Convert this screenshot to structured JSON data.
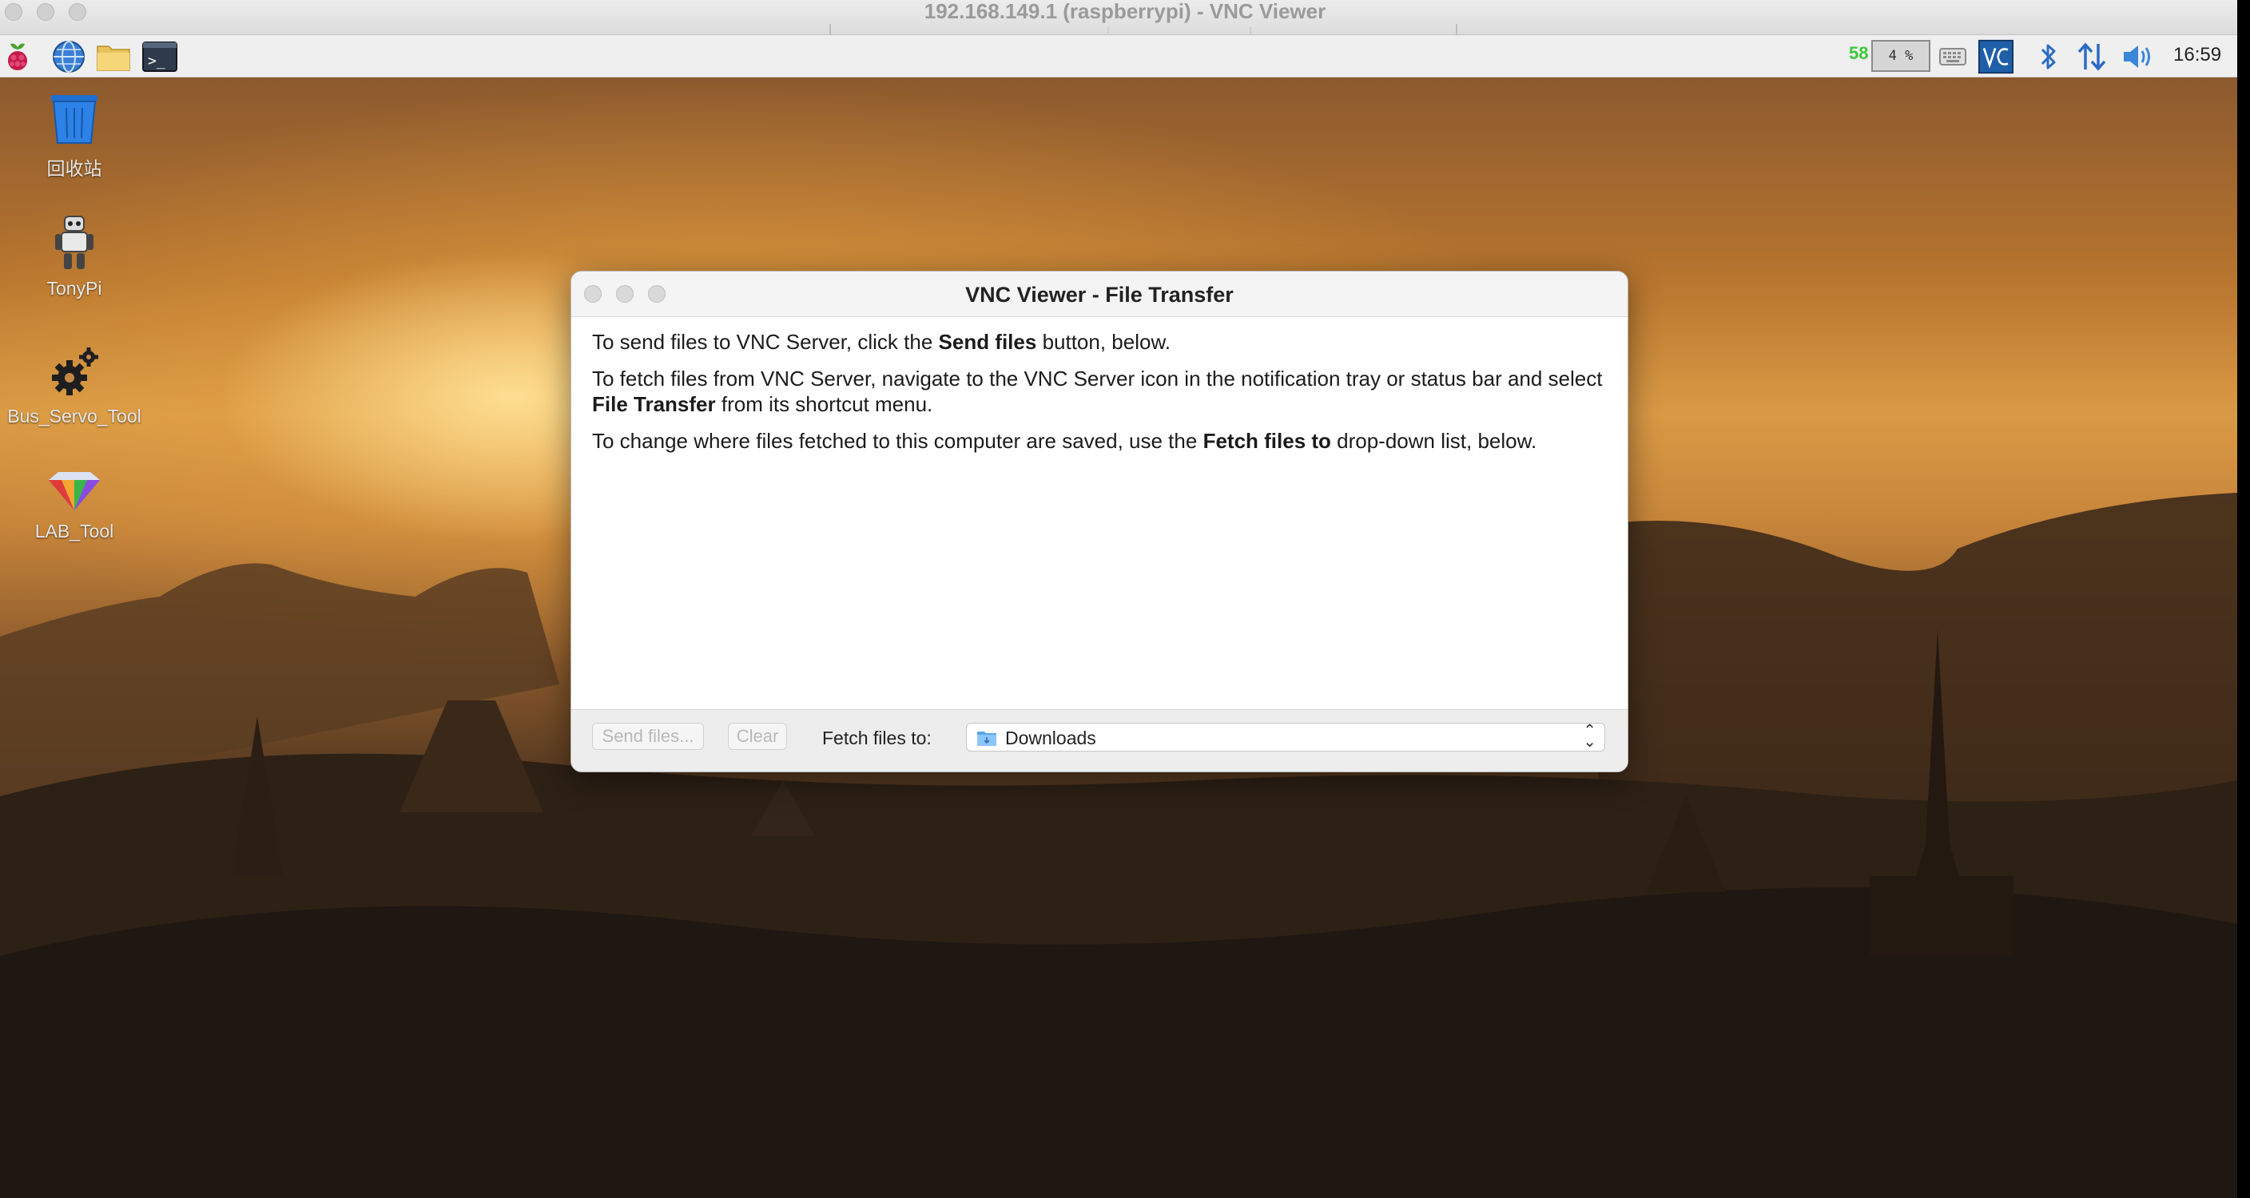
{
  "window": {
    "title": "192.168.149.1 (raspberrypi) - VNC Viewer"
  },
  "panel": {
    "launchers": [
      {
        "name": "raspberry-menu-icon"
      },
      {
        "name": "web-browser-icon"
      },
      {
        "name": "file-manager-icon"
      },
      {
        "name": "terminal-icon"
      }
    ],
    "cpu_temp": "58",
    "cpu_usage": "4 %",
    "clock": "16:59",
    "tray_icons": [
      "keyboard-icon",
      "vnc-icon",
      "bluetooth-icon",
      "network-icon",
      "volume-icon"
    ]
  },
  "desktop": {
    "icons": [
      {
        "label": "回收站",
        "icon": "trash-icon"
      },
      {
        "label": "TonyPi",
        "icon": "robot-icon"
      },
      {
        "label": "Bus_Servo_Tool",
        "icon": "gear-icon"
      },
      {
        "label": "LAB_Tool",
        "icon": "diamond-icon"
      }
    ]
  },
  "dialog": {
    "title": "VNC Viewer - File Transfer",
    "para1": {
      "pre": "To send files to VNC Server, click the ",
      "bold": "Send files",
      "post": " button, below."
    },
    "para2": {
      "pre": "To fetch files from VNC Server, navigate to the VNC Server icon in the notification tray or status bar and select ",
      "bold": "File Transfer",
      "post": " from its shortcut menu."
    },
    "para3": {
      "pre": "To change where files fetched to this computer are saved, use the ",
      "bold": "Fetch files to",
      "post": " drop-down list, below."
    },
    "send_button": "Send files...",
    "clear_button": "Clear",
    "fetch_label": "Fetch files to:",
    "fetch_value": "Downloads"
  },
  "colors": {
    "temp_green": "#3cc83c",
    "vnc_blue": "#1f5fa8"
  }
}
